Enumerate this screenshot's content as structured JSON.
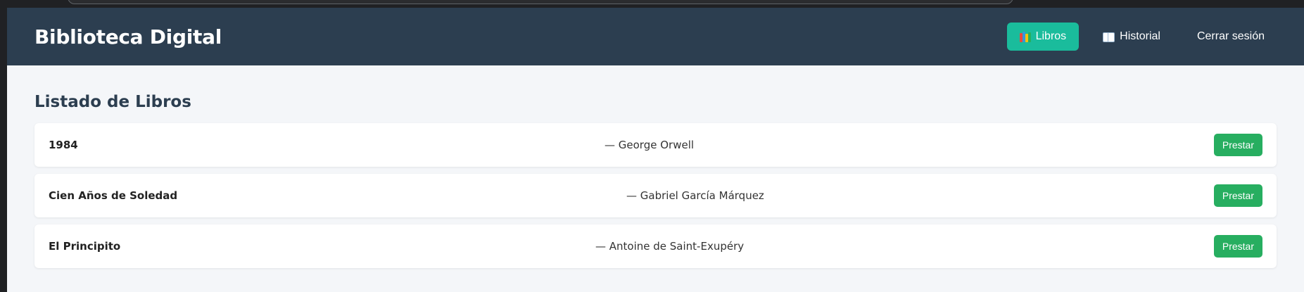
{
  "navbar": {
    "brand": "Biblioteca Digital",
    "links": [
      {
        "label": "Libros",
        "icon": "books-icon",
        "active": true
      },
      {
        "label": "Historial",
        "icon": "open-book-icon",
        "active": false
      },
      {
        "label": "Cerrar sesión",
        "icon": null,
        "active": false
      }
    ]
  },
  "main": {
    "title": "Listado de Libros",
    "books": [
      {
        "title": "1984",
        "author": "— George Orwell",
        "action": "Prestar"
      },
      {
        "title": "Cien Años de Soledad",
        "author": "— Gabriel García Márquez",
        "action": "Prestar"
      },
      {
        "title": "El Principito",
        "author": "— Antoine de Saint-Exupéry",
        "action": "Prestar"
      }
    ]
  },
  "colors": {
    "navbar_bg": "#2c3e50",
    "active_link": "#1abc9c",
    "lend_button": "#27ae60",
    "page_bg": "#f4f6f9"
  }
}
